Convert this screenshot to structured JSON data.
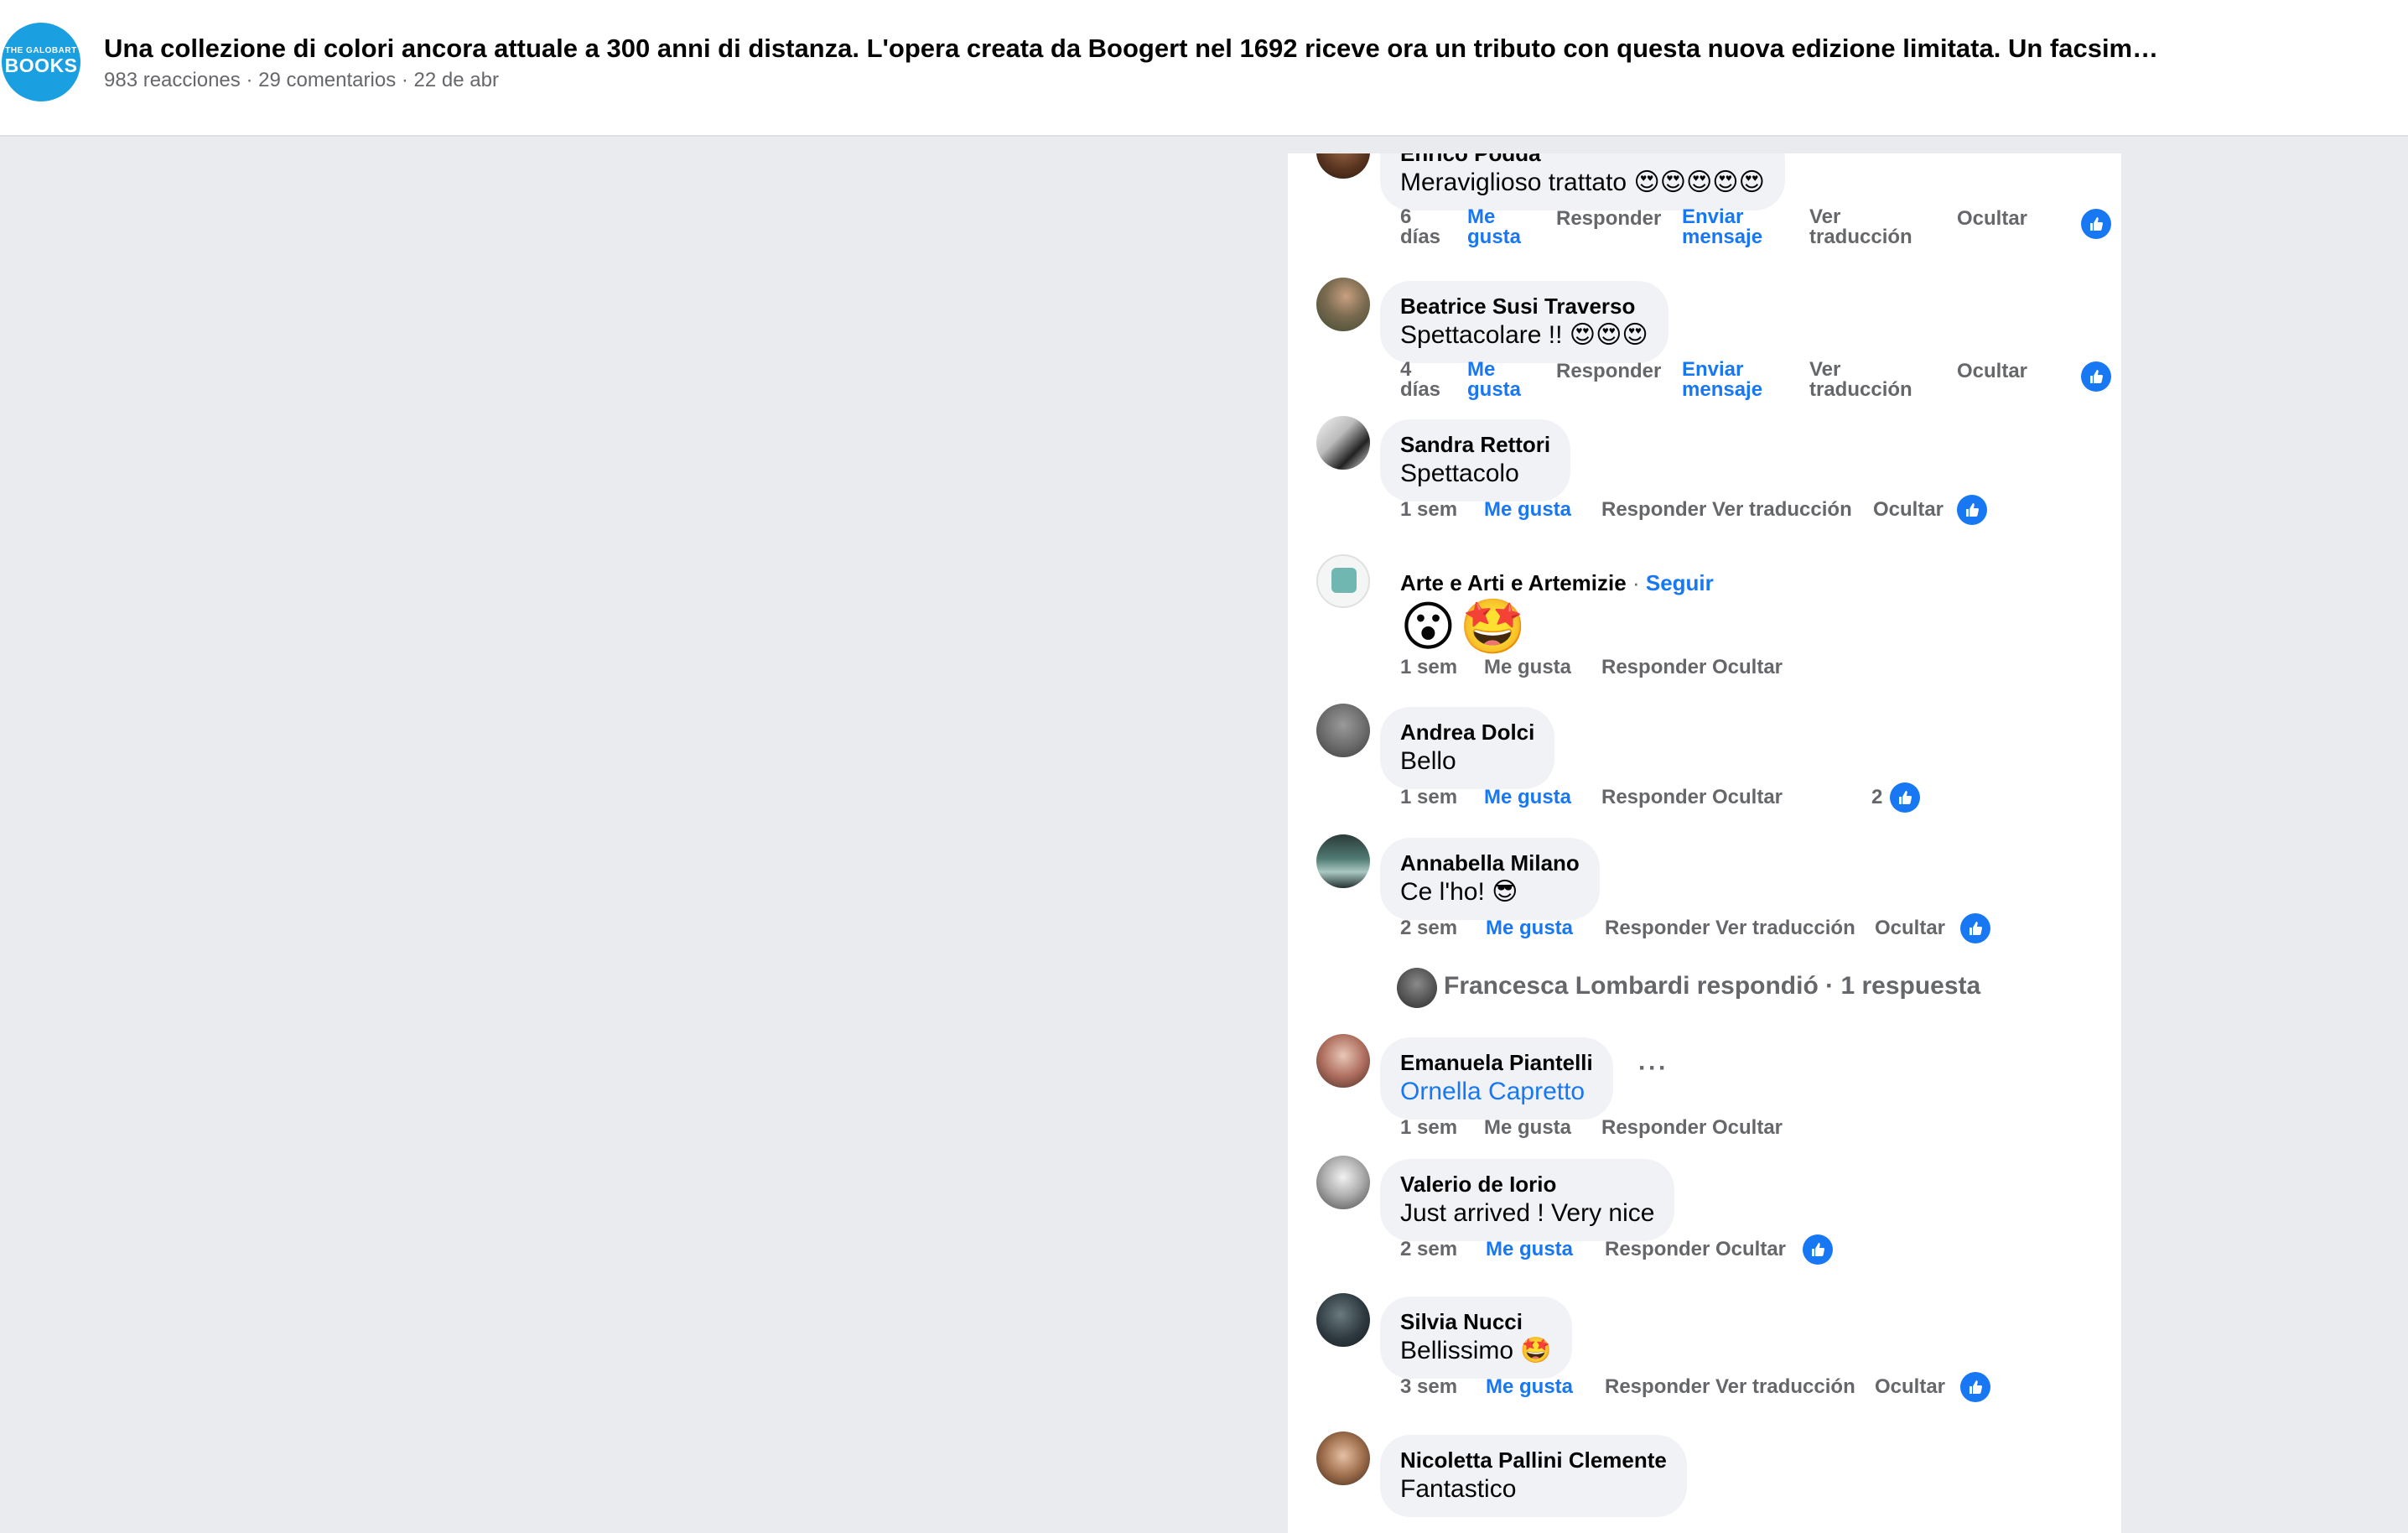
{
  "post": {
    "page_logo": {
      "line1": "THE GALOBART",
      "line2": "BOOKS"
    },
    "title": "Una collezione di colori ancora attuale a 300 anni di distanza. L'opera creata da Boogert nel 1692 riceve ora un tributo con questa nuova edizione limitata. Un facsim…",
    "meta": "983 reacciones · 29 comentarios · 22 de abr"
  },
  "comments": [
    {
      "author": "Enrico Podda",
      "text": "Meraviglioso trattato",
      "emoji": "😍😍😍😍😍",
      "time": "6 días",
      "like": "Me gusta",
      "reply": "Responder",
      "message": "Enviar mensaje",
      "translate": "Ver traducción",
      "hide": "Ocultar"
    },
    {
      "author": "Beatrice Susi Traverso",
      "text": "Spettacolare !!",
      "emoji": "😍😍😍",
      "time": "4 días",
      "like": "Me gusta",
      "reply": "Responder",
      "message": "Enviar mensaje",
      "translate": "Ver traducción",
      "hide": "Ocultar"
    },
    {
      "author": "Sandra Rettori",
      "text": "Spettacolo",
      "time": "1 sem",
      "like": "Me gusta",
      "reply": "Responder",
      "translate": "Ver traducción",
      "hide": "Ocultar"
    },
    {
      "author": "Arte e Arti e Artemizie",
      "follow": "Seguir",
      "emoji_big": [
        "😮",
        "🤩"
      ],
      "time": "1 sem",
      "like": "Me gusta",
      "reply": "Responder",
      "hide": "Ocultar"
    },
    {
      "author": "Andrea Dolci",
      "text": "Bello",
      "time": "1 sem",
      "like": "Me gusta",
      "reply": "Responder",
      "hide": "Ocultar",
      "like_count": "2"
    },
    {
      "author": "Annabella Milano",
      "text": "Ce l'ho!",
      "emoji": "😎",
      "time": "2 sem",
      "like": "Me gusta",
      "reply": "Responder",
      "translate": "Ver traducción",
      "hide": "Ocultar",
      "replies": "Francesca Lombardi respondió · 1 respuesta"
    },
    {
      "author": "Emanuela Piantelli",
      "text": "Ornella Capretto",
      "more": "···",
      "time": "1 sem",
      "like": "Me gusta",
      "reply": "Responder",
      "hide": "Ocultar"
    },
    {
      "author": "Valerio de Iorio",
      "text": "Just arrived ! Very nice",
      "time": "2 sem",
      "like": "Me gusta",
      "reply": "Responder",
      "hide": "Ocultar"
    },
    {
      "author": "Silvia Nucci",
      "text": "Bellissimo",
      "emoji": "🤩",
      "time": "3 sem",
      "like": "Me gusta",
      "reply": "Responder",
      "translate": "Ver traducción",
      "hide": "Ocultar"
    },
    {
      "author": "Nicoletta Pallini Clemente",
      "text": "Fantastico"
    }
  ],
  "colors": {
    "accent": "#1877f2",
    "secondary_text": "#65676b",
    "bubble": "#f0f2f5",
    "page_bg": "#e9ebee",
    "logo": "#1a9fe0"
  }
}
